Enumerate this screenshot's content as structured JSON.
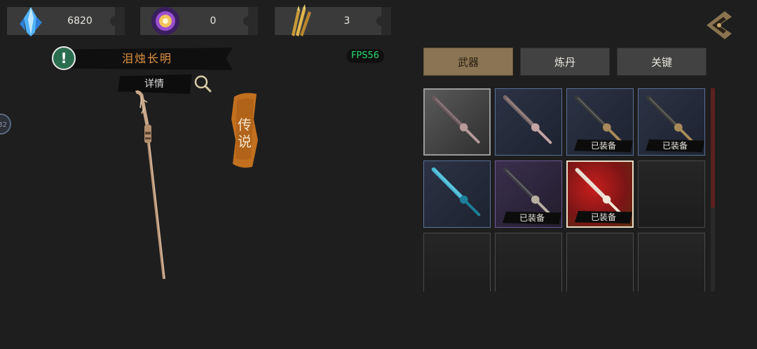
{
  "currencies": [
    {
      "icon": "blue-crystal-icon",
      "amount": "6820"
    },
    {
      "icon": "golden-orb-icon",
      "amount": "0"
    },
    {
      "icon": "golden-arrows-icon",
      "amount": "3"
    }
  ],
  "weapon": {
    "name": "泪烛长明",
    "detail_label": "详情",
    "rarity": "传说",
    "name_color": "#e0913f"
  },
  "fps_label": "FPS56",
  "side_badge": "32",
  "tabs": [
    {
      "label": "武器",
      "active": true
    },
    {
      "label": "炼丹",
      "active": false
    },
    {
      "label": "关键",
      "active": false
    }
  ],
  "inventory": [
    {
      "rarity": "grey",
      "equipped_label": ""
    },
    {
      "rarity": "blue",
      "equipped_label": ""
    },
    {
      "rarity": "blue",
      "equipped_label": "已装备"
    },
    {
      "rarity": "blue",
      "equipped_label": "已装备"
    },
    {
      "rarity": "blue",
      "equipped_label": ""
    },
    {
      "rarity": "purple",
      "equipped_label": "已装备"
    },
    {
      "rarity": "red",
      "equipped_label": "已装备"
    },
    {
      "rarity": "empty",
      "equipped_label": ""
    },
    {
      "rarity": "empty",
      "equipped_label": ""
    },
    {
      "rarity": "empty",
      "equipped_label": ""
    },
    {
      "rarity": "empty",
      "equipped_label": ""
    },
    {
      "rarity": "empty",
      "equipped_label": ""
    }
  ]
}
